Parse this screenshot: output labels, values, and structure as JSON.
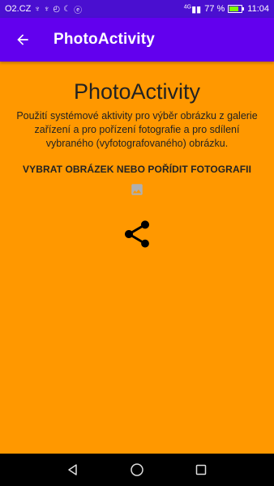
{
  "status_bar": {
    "carrier": "O2.CZ",
    "signal_label": "4G",
    "battery_percent": "77 %",
    "time": "11:04",
    "icons": [
      "usb-icon",
      "usb-icon",
      "sync-icon",
      "moon-icon",
      "nfc-icon"
    ]
  },
  "app_bar": {
    "title": "PhotoActivity",
    "back_icon": "arrow-back-icon",
    "background": "#6200EE"
  },
  "main": {
    "title": "PhotoActivity",
    "description": "Použití systémové aktivity pro výběr obrázku z galerie zařízení a pro pořízení fotografie a pro sdílení vybraného (vyfotografovaného) obrázku.",
    "pick_button_label": "VYBRAT OBRÁZEK NEBO POŘÍDIT FOTOGRAFII",
    "image_icon": "image-icon",
    "share_icon": "share-icon",
    "background": "#FF9800"
  },
  "nav_bar": {
    "buttons": [
      "back-triangle-icon",
      "home-circle-icon",
      "recents-square-icon"
    ]
  }
}
